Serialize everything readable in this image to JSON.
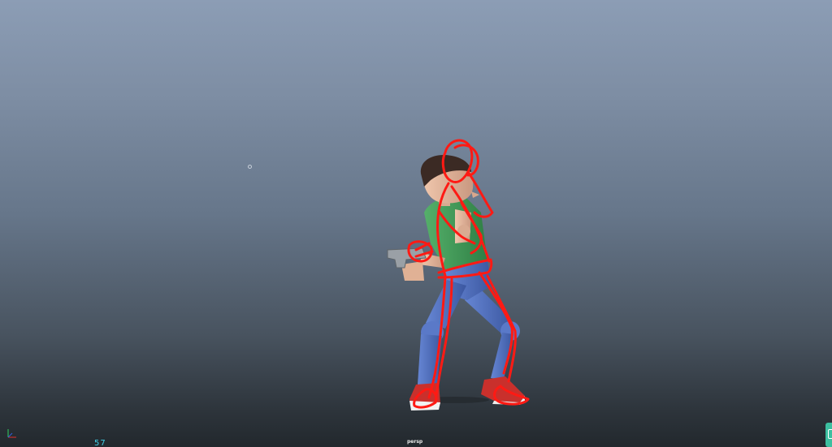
{
  "viewport": {
    "camera_label": "persp",
    "frame_counter": "57"
  },
  "icons": {
    "axis_gizmo": "axis-gizmo-icon",
    "panel_tab": "panel-tab-icon"
  },
  "colors": {
    "sketch_stroke": "#ff1a14",
    "frame_counter": "#3fd0e8",
    "shirt": "#3e9a55",
    "pants": "#4d6fc0",
    "skin": "#e2b49a",
    "hair": "#3b2a24",
    "shoes": "#c9302c"
  }
}
